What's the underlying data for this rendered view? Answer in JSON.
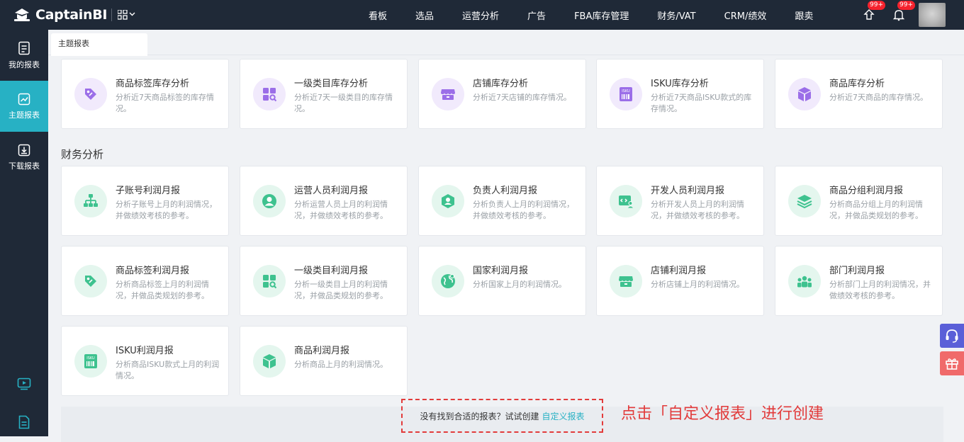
{
  "brand": {
    "name": "CaptainBI"
  },
  "nav": {
    "items": [
      "看板",
      "选品",
      "运营分析",
      "广告",
      "FBA库存管理",
      "财务/VAT",
      "CRM/绩效",
      "跟卖"
    ]
  },
  "badges": {
    "upload": "99+",
    "bell": "99+"
  },
  "sidebar": {
    "items": [
      {
        "label": "我的报表",
        "icon": "report-doc-icon"
      },
      {
        "label": "主题报表",
        "icon": "chart-icon"
      },
      {
        "label": "下载报表",
        "icon": "download-icon"
      }
    ]
  },
  "tabs": [
    "主题报表"
  ],
  "inventory_cards": [
    {
      "title": "商品标签库存分析",
      "desc": "分析近7天商品标签的库存情况。",
      "icon": "tag-icon",
      "color": "#9b6ee8"
    },
    {
      "title": "一级类目库存分析",
      "desc": "分析近7天一级类目的库存情况。",
      "icon": "category-search-icon",
      "color": "#9b6ee8"
    },
    {
      "title": "店铺库存分析",
      "desc": "分析近7天店铺的库存情况。",
      "icon": "store-icon",
      "color": "#9b6ee8"
    },
    {
      "title": "ISKU库存分析",
      "desc": "分析近7天商品ISKU款式的库存情况。",
      "icon": "isku-icon",
      "color": "#9b6ee8"
    },
    {
      "title": "商品库存分析",
      "desc": "分析近7天商品的库存情况。",
      "icon": "box-icon",
      "color": "#9b6ee8"
    }
  ],
  "finance_section": {
    "title": "财务分析"
  },
  "finance_cards": [
    {
      "title": "子账号利润月报",
      "desc": "分析子账号上月的利润情况，并做绩效考核的参考。",
      "icon": "org-chart-icon"
    },
    {
      "title": "运营人员利润月报",
      "desc": "分析运营人员上月的利润情况，并做绩效考核的参考。",
      "icon": "person-icon"
    },
    {
      "title": "负责人利润月报",
      "desc": "分析负责人上月的利润情况，并做绩效考核的参考。",
      "icon": "owner-icon"
    },
    {
      "title": "开发人员利润月报",
      "desc": "分析开发人员上月的利润情况，并做绩效考核的参考。",
      "icon": "developer-icon"
    },
    {
      "title": "商品分组利润月报",
      "desc": "分析商品分组上月的利润情况，并做品类规划的参考。",
      "icon": "layers-icon"
    },
    {
      "title": "商品标签利润月报",
      "desc": "分析商品标签上月的利润情况，并做品类规划的参考。",
      "icon": "tag-icon"
    },
    {
      "title": "一级类目利润月报",
      "desc": "分析一级类目上月的利润情况，并做品类规划的参考。",
      "icon": "category-search-icon"
    },
    {
      "title": "国家利润月报",
      "desc": "分析国家上月的利润情况。",
      "icon": "globe-icon"
    },
    {
      "title": "店铺利润月报",
      "desc": "分析店铺上月的利润情况。",
      "icon": "store-icon"
    },
    {
      "title": "部门利润月报",
      "desc": "分析部门上月的利润情况，并做绩效考核的参考。",
      "icon": "team-icon"
    },
    {
      "title": "ISKU利润月报",
      "desc": "分析商品ISKU款式上月的利润情况。",
      "icon": "isku-icon"
    },
    {
      "title": "商品利润月报",
      "desc": "分析商品上月的利润情况。",
      "icon": "box-icon"
    }
  ],
  "hint": {
    "text": "没有找到合适的报表？试试创建",
    "link": "自定义报表"
  },
  "annotation": "点击「自定义报表」进行创建",
  "colors": {
    "accent": "#27b1c4",
    "purple": "#9b6ee8",
    "green": "#3ec28f",
    "red": "#e23b3b",
    "sidebar": "#1f2937"
  }
}
